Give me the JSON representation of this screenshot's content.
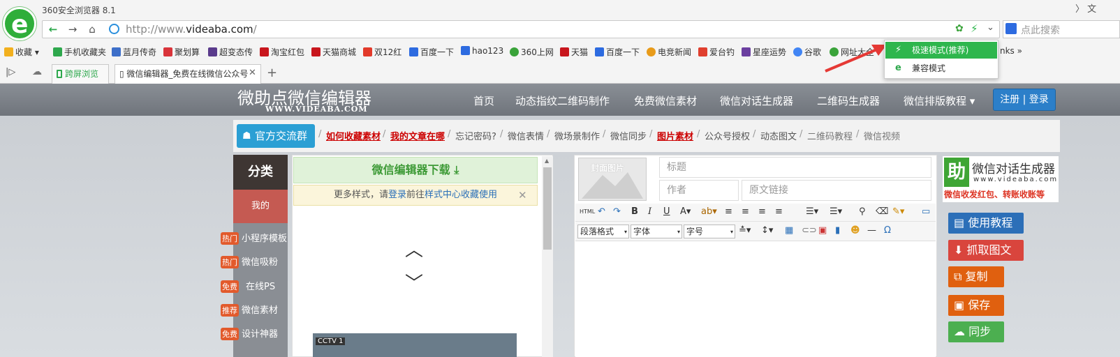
{
  "browser": {
    "title": "360安全浏览器 8.1",
    "top_right": "文",
    "url_prefix": "http://www.",
    "url_domain": "videaba.com",
    "url_suffix": "/",
    "search_placeholder": "点此搜索",
    "bookmarks": [
      {
        "label": "收藏",
        "color": "#f2b01e"
      },
      {
        "label": "手机收藏夹",
        "color": "#2ea84d"
      },
      {
        "label": "蓝月传奇",
        "color": "#3d6fc9"
      },
      {
        "label": "聚划算",
        "color": "#d9343a"
      },
      {
        "label": "超变态传",
        "color": "#5a3b8c"
      },
      {
        "label": "淘宝红包",
        "color": "#c8161d"
      },
      {
        "label": "天猫商城",
        "color": "#c8161d"
      },
      {
        "label": "双12红",
        "color": "#e23a2a"
      },
      {
        "label": "百度一下",
        "color": "#2d6be0"
      },
      {
        "label": "hao123",
        "color": "#2d6be0"
      },
      {
        "label": "360上网",
        "color": "#3aa33a"
      },
      {
        "label": "天猫",
        "color": "#c8161d"
      },
      {
        "label": "百度一下",
        "color": "#2d6be0"
      },
      {
        "label": "电竞新闻",
        "color": "#e89b1a"
      },
      {
        "label": "爱台钓",
        "color": "#e03f2e"
      },
      {
        "label": "星座运势",
        "color": "#6b3fa0"
      },
      {
        "label": "谷歌",
        "color": "#4285f4"
      },
      {
        "label": "网址大全",
        "color": "#3aa33a"
      }
    ],
    "bookmark_more": "nks",
    "tabs": [
      {
        "label": "跨屏浏览"
      },
      {
        "label": "微信编辑器_免费在线微信公众号"
      }
    ],
    "dropdown": {
      "items": [
        "极速模式(推荐)",
        "兼容模式"
      ]
    }
  },
  "site": {
    "logo": "微助点微信编辑器",
    "logo_sub": "WWW.VIDEABA.COM",
    "nav": [
      "首页",
      "动态指纹二维码制作",
      "免费微信素材",
      "微信对话生成器",
      "二维码生成器",
      "微信排版教程"
    ],
    "login": "注册 | 登录",
    "qq_group": "官方交流群",
    "sub_links": [
      {
        "label": "如何收藏素材",
        "red": true
      },
      {
        "label": "我的文章在哪",
        "red": true
      },
      {
        "label": "忘记密码?",
        "red": false
      },
      {
        "label": "微信表情",
        "red": false
      },
      {
        "label": "微场景制作",
        "red": false
      },
      {
        "label": "微信同步",
        "red": false
      },
      {
        "label": "图片素材",
        "red": true
      },
      {
        "label": "公众号授权",
        "red": false
      },
      {
        "label": "动态图文",
        "red": false
      },
      {
        "label": "二维码教程",
        "red": false
      },
      {
        "label": "微信视频",
        "red": false
      }
    ],
    "category": {
      "title": "分类",
      "mine": "我的",
      "items": [
        {
          "badge": "热门",
          "label": "小程序模板"
        },
        {
          "badge": "热门",
          "label": "微信吸粉"
        },
        {
          "badge": "免费",
          "label": "在线PS"
        },
        {
          "badge": "推荐",
          "label": "微信素材"
        },
        {
          "badge": "免费",
          "label": "设计神器"
        }
      ]
    },
    "preview": {
      "download": "微信编辑器下载",
      "more_prefix": "更多样式，请",
      "more_link1": "登录",
      "more_mid": "前往",
      "more_link2": "样式中心收藏使用",
      "video_logo": "CCTV 1"
    },
    "editor": {
      "cover": "封面图片",
      "title_placeholder": "标题",
      "author_placeholder": "作者",
      "source_placeholder": "原文链接",
      "html_btn": "HTML",
      "para_select": "段落格式",
      "font_select": "字体",
      "size_select": "字号"
    },
    "right": {
      "ad_char": "助",
      "ad_title": "微信对话生成器",
      "ad_url": "www.videaba.com",
      "ad_red": "微信收发红包、转账收账等",
      "buttons": [
        {
          "label": "使用教程",
          "color": "#2c6fb8"
        },
        {
          "label": "抓取图文",
          "color": "#d9453d"
        },
        {
          "label": "复制",
          "color": "#e0600f"
        },
        {
          "label": "保存",
          "color": "#e0600f"
        },
        {
          "label": "同步",
          "color": "#4caf50"
        }
      ]
    }
  }
}
